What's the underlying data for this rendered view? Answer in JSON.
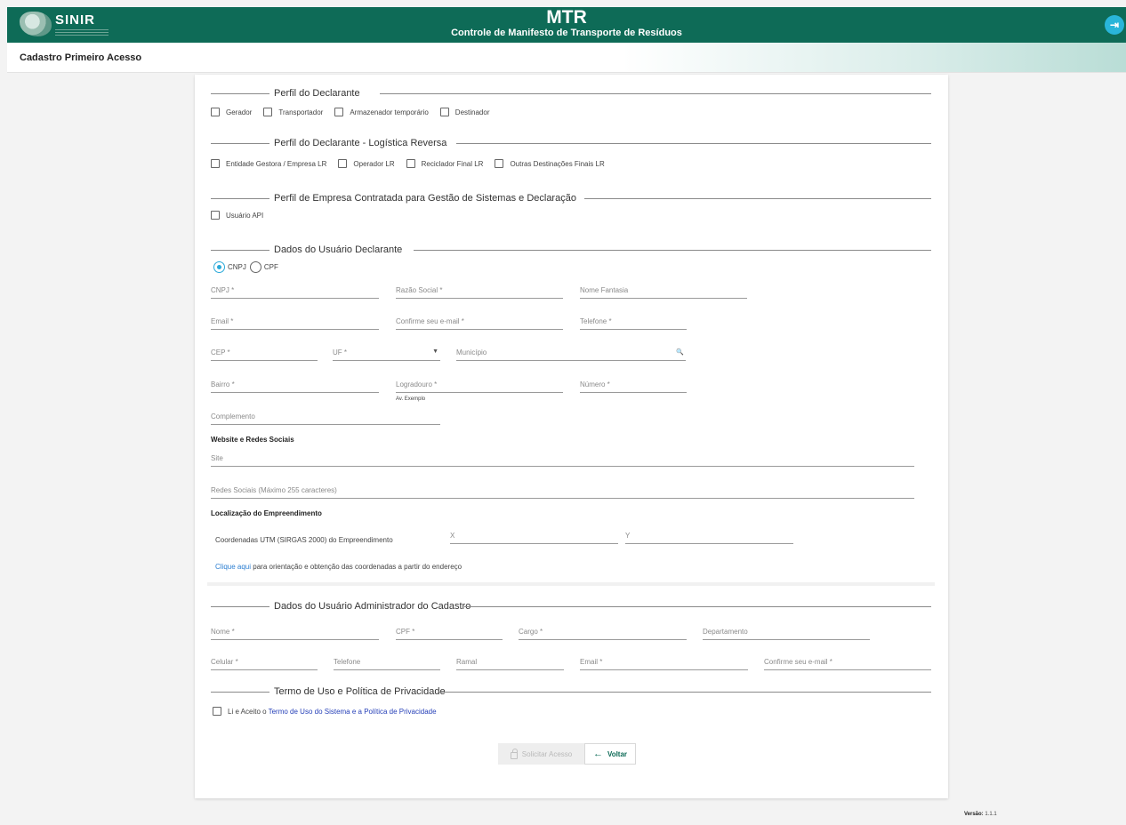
{
  "header": {
    "logo_text": "SINIR",
    "title": "MTR",
    "subtitle": "Controle de Manifesto de Transporte de Resíduos",
    "exit_icon": "exit-icon"
  },
  "subheader": {
    "title": "Cadastro Primeiro Acesso"
  },
  "perfil": {
    "legend": "Perfil do Declarante",
    "options": [
      "Gerador",
      "Transportador",
      "Armazenador temporário",
      "Destinador"
    ]
  },
  "reversa": {
    "legend": "Perfil do Declarante - Logística Reversa",
    "options": [
      "Entidade Gestora / Empresa LR",
      "Operador LR",
      "Reciclador Final LR",
      "Outras Destinações Finais LR"
    ]
  },
  "contratada": {
    "legend": "Perfil de Empresa Contratada para Gestão de Sistemas e Declaração",
    "options": [
      "Usuário API"
    ]
  },
  "declarante": {
    "legend": "Dados do Usuário Declarante",
    "radio_cnpj": "CNPJ",
    "radio_cpf": "CPF",
    "selected": "CNPJ",
    "fields": {
      "cnpj": "CNPJ *",
      "razao": "Razão Social *",
      "fantasia": "Nome Fantasia",
      "email": "Email *",
      "confirm_email": "Confirme seu e-mail *",
      "telefone": "Telefone *",
      "cep": "CEP *",
      "uf": "UF *",
      "municipio": "Município",
      "bairro": "Bairro *",
      "logradouro": "Logradouro *",
      "logradouro_hint": "Av. Exemplo",
      "numero": "Número *",
      "complemento": "Complemento"
    }
  },
  "web": {
    "label": "Website e Redes Sociais",
    "site": "Site",
    "redes": "Redes Sociais (Máximo 255 caracteres)"
  },
  "loc": {
    "label": "Localização do Empreendimento",
    "coords_label": "Coordenadas UTM (SIRGAS 2000) do Empreendimento",
    "x": "X",
    "y": "Y",
    "link_text": "Clique aqui",
    "link_rest": " para orientação e obtenção das coordenadas a partir do endereço"
  },
  "admin": {
    "legend": "Dados do Usuário Administrador do Cadastro",
    "nome": "Nome *",
    "cpf": "CPF *",
    "cargo": "Cargo *",
    "departamento": "Departamento",
    "celular": "Celular *",
    "telefone": "Telefone",
    "ramal": "Ramal",
    "email": "Email *",
    "confirm_email": "Confirme seu e-mail *"
  },
  "termo": {
    "legend": "Termo de Uso e Política de Privacidade",
    "prefix": "Li e Aceito o ",
    "link": "Termo de Uso do Sistema e a Política de Privacidade"
  },
  "buttons": {
    "solicitar": "Solicitar Acesso",
    "voltar": "Voltar"
  },
  "footer": {
    "version_label": "Versão:",
    "version": "1.1.1"
  },
  "colors": {
    "header": "#0e6b57",
    "accent": "#29a9d9",
    "link": "#2b7ed1"
  }
}
